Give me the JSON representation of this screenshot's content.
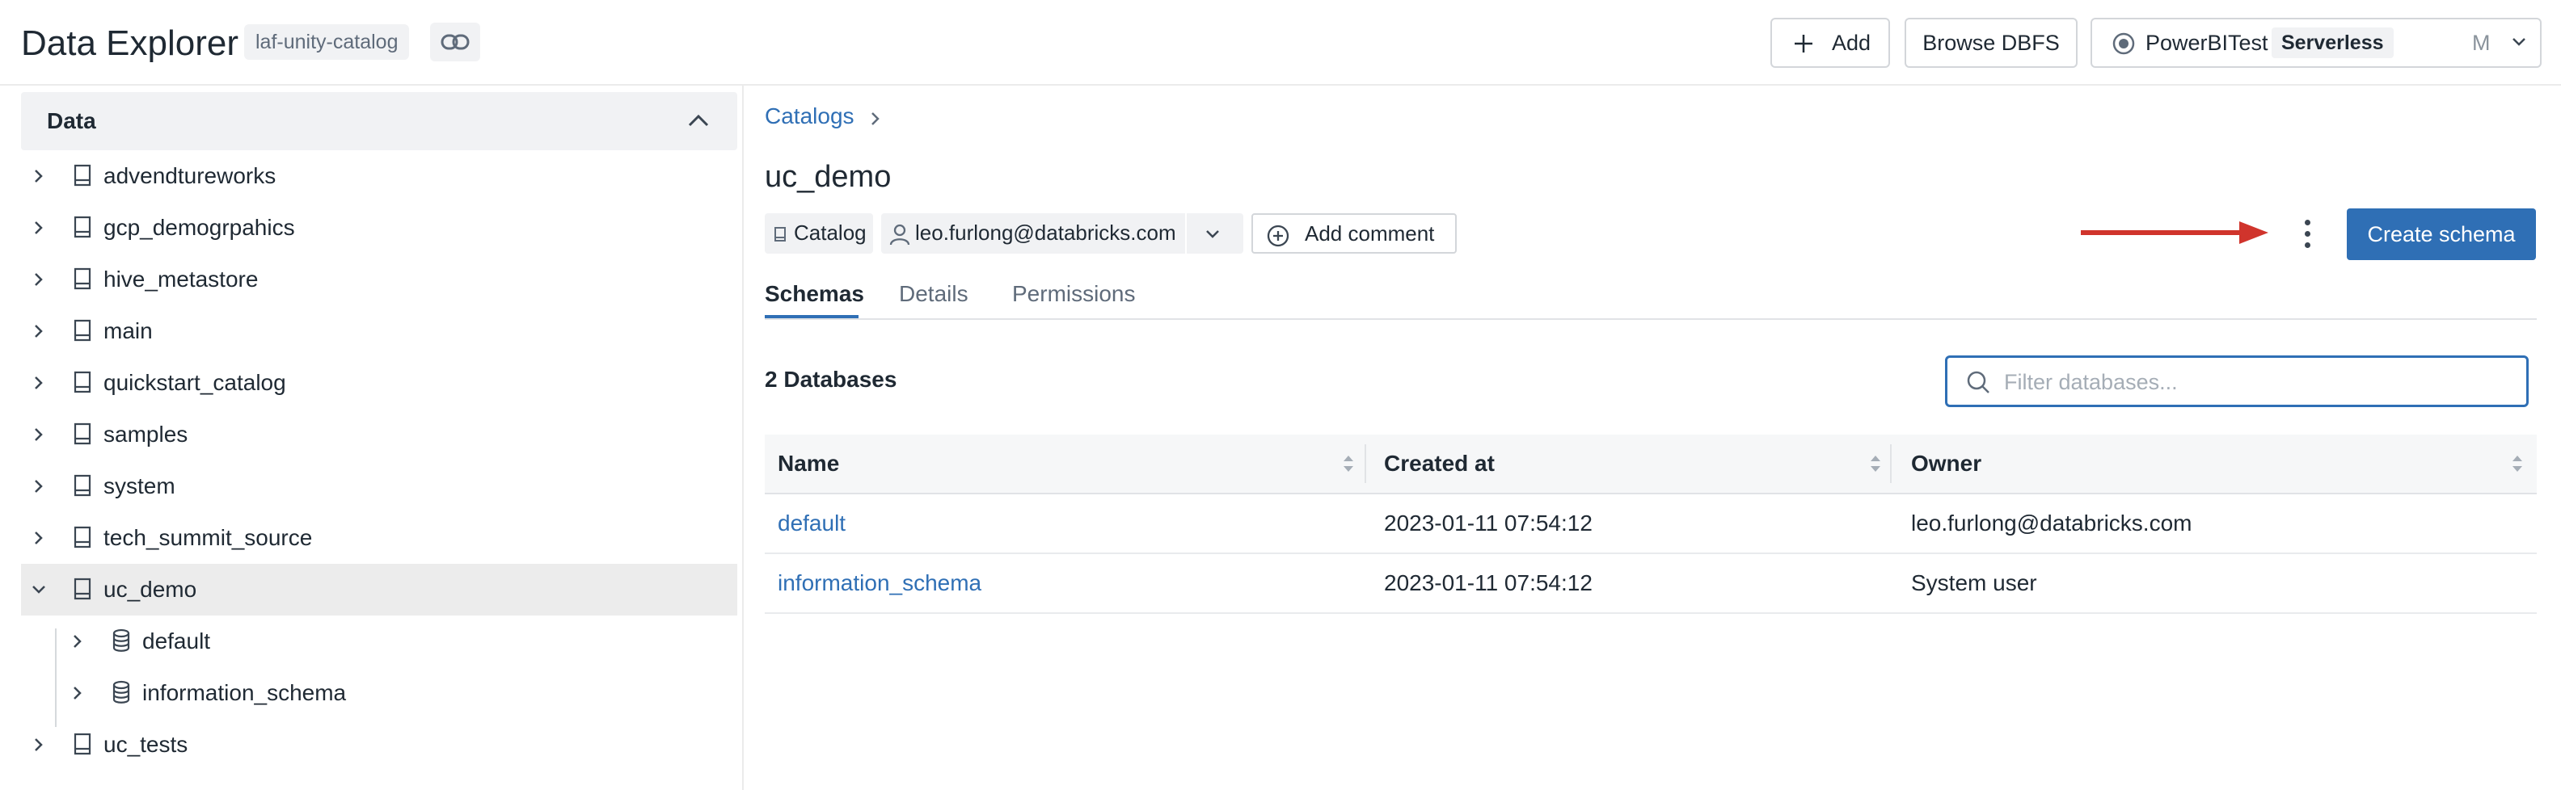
{
  "header": {
    "title": "Data Explorer",
    "catalog_pill": "laf-unity-catalog",
    "add_label": "Add",
    "browse_label": "Browse DBFS",
    "cluster_name": "PowerBITest",
    "cluster_type": "Serverless",
    "cluster_size": "M"
  },
  "sidebar": {
    "section_label": "Data",
    "items": [
      {
        "label": "advendtureworks"
      },
      {
        "label": "gcp_demogrpahics"
      },
      {
        "label": "hive_metastore"
      },
      {
        "label": "main"
      },
      {
        "label": "quickstart_catalog"
      },
      {
        "label": "samples"
      },
      {
        "label": "system"
      },
      {
        "label": "tech_summit_source"
      },
      {
        "label": "uc_demo",
        "expanded": true,
        "selected": true
      },
      {
        "label": "default",
        "child": true
      },
      {
        "label": "information_schema",
        "child": true
      },
      {
        "label": "uc_tests"
      }
    ]
  },
  "main": {
    "breadcrumb": "Catalogs",
    "catalog_title": "uc_demo",
    "type_chip": "Catalog",
    "owner": "leo.furlong@databricks.com",
    "add_comment_label": "Add comment",
    "create_label": "Create schema",
    "tabs": [
      {
        "label": "Schemas",
        "active": true
      },
      {
        "label": "Details"
      },
      {
        "label": "Permissions"
      }
    ],
    "db_count": "2 Databases",
    "filter_placeholder": "Filter databases...",
    "columns": [
      "Name",
      "Created at",
      "Owner"
    ],
    "rows": [
      {
        "name": "default",
        "created": "2023-01-11 07:54:12",
        "owner": "leo.furlong@databricks.com"
      },
      {
        "name": "information_schema",
        "created": "2023-01-11 07:54:12",
        "owner": "System user"
      }
    ]
  },
  "colors": {
    "accent": "#2f6fb5",
    "arrow": "#d0342c",
    "selected_bg": "#ececec"
  }
}
